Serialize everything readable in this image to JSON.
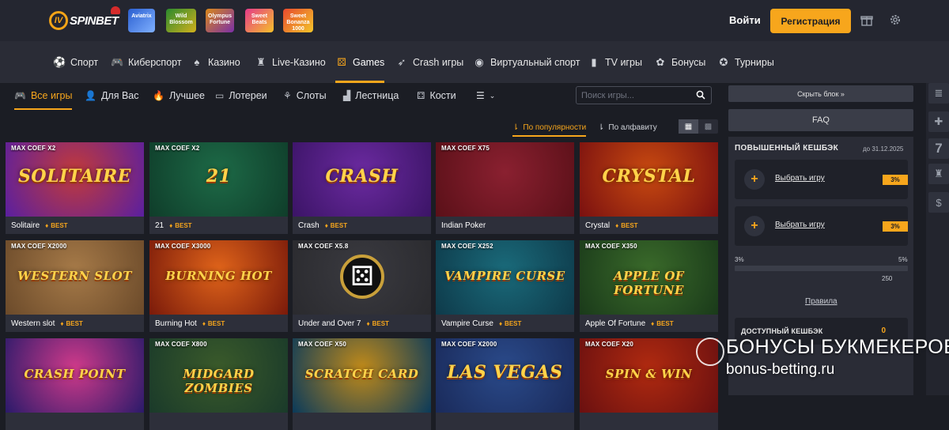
{
  "header": {
    "logo_text": "SPINBET",
    "promos": [
      "Aviatrix",
      "Wild Blossom",
      "Olympus Fortune",
      "Sweet Beats",
      "Sweet Bonanza 1000"
    ],
    "login_label": "Войти",
    "register_label": "Регистрация"
  },
  "main_nav": {
    "items": [
      {
        "label": "Спорт",
        "icon": "soccer-ball-icon"
      },
      {
        "label": "Киберспорт",
        "icon": "gamepad-icon"
      },
      {
        "label": "Казино",
        "icon": "cards-icon"
      },
      {
        "label": "Live-Казино",
        "icon": "dealer-icon"
      },
      {
        "label": "Games",
        "icon": "dice-icon"
      },
      {
        "label": "Crash игры",
        "icon": "rocket-icon"
      },
      {
        "label": "Виртуальный спорт",
        "icon": "controller-icon"
      },
      {
        "label": "TV игры",
        "icon": "tv-icon"
      },
      {
        "label": "Бонусы",
        "icon": "gift-icon"
      },
      {
        "label": "Турниры",
        "icon": "trophy-icon"
      }
    ],
    "active": "Games"
  },
  "sub_nav": {
    "items": [
      "Все игры",
      "Для Вас",
      "Лучшее",
      "Лотереи",
      "Слоты",
      "Лестница",
      "Кости"
    ],
    "active": "Все игры"
  },
  "search": {
    "placeholder": "Поиск игры..."
  },
  "sort": {
    "popular": "По популярности",
    "alpha": "По алфавиту",
    "active": "popular"
  },
  "games": [
    {
      "name": "Solitaire",
      "coef": "MAX COEF X2",
      "best": true,
      "art_title": "SOLITAIRE",
      "bg": [
        "#5a1fa0",
        "#c23a3a"
      ]
    },
    {
      "name": "21",
      "coef": "MAX COEF X2",
      "best": true,
      "art_title": "21",
      "bg": [
        "#0f3d2a",
        "#1d6a47"
      ]
    },
    {
      "name": "Crash",
      "coef": "",
      "best": true,
      "art_title": "CRASH",
      "bg": [
        "#3b1466",
        "#6b2aa0"
      ]
    },
    {
      "name": "Indian Poker",
      "coef": "MAX COEF X75",
      "best": false,
      "art_title": "",
      "bg": [
        "#5a1018",
        "#8a2030"
      ]
    },
    {
      "name": "Crystal",
      "coef": "",
      "best": true,
      "art_title": "CRYSTAL",
      "bg": [
        "#7a1010",
        "#c84a10"
      ]
    },
    {
      "name": "Western slot",
      "coef": "MAX COEF X2000",
      "best": true,
      "art_title": "WESTERN SLOT",
      "bg": [
        "#6b4a2a",
        "#a67a48"
      ]
    },
    {
      "name": "Burning Hot",
      "coef": "MAX COEF X3000",
      "best": true,
      "art_title": "BURNING HOT",
      "bg": [
        "#7a1a0a",
        "#e0641a"
      ]
    },
    {
      "name": "Under and Over 7",
      "coef": "MAX COEF X5.8",
      "best": true,
      "art_title": "",
      "bg": [
        "#2a2a2e",
        "#3a3a40"
      ]
    },
    {
      "name": "Vampire Curse",
      "coef": "MAX COEF X252",
      "best": true,
      "art_title": "VAMPIRE CURSE",
      "bg": [
        "#0e3a4a",
        "#1a6a7a"
      ]
    },
    {
      "name": "Apple Of Fortune",
      "coef": "MAX COEF X350",
      "best": true,
      "art_title": "APPLE OF FORTUNE",
      "bg": [
        "#1a3a1a",
        "#3a6a2a"
      ]
    },
    {
      "name": "",
      "coef": "",
      "best": false,
      "art_title": "CRASH POINT",
      "bg": [
        "#2a1a6a",
        "#d03a8a"
      ]
    },
    {
      "name": "",
      "coef": "MAX COEF X800",
      "best": false,
      "art_title": "MIDGARD ZOMBIES",
      "bg": [
        "#1a3a2a",
        "#3a5a2a"
      ]
    },
    {
      "name": "",
      "coef": "MAX COEF X50",
      "best": false,
      "art_title": "SCRATCH CARD",
      "bg": [
        "#0a3a5a",
        "#c08a1a"
      ]
    },
    {
      "name": "",
      "coef": "MAX COEF X2000",
      "best": false,
      "art_title": "LAS VEGAS",
      "bg": [
        "#1a2a5a",
        "#2a4a8a"
      ]
    },
    {
      "name": "",
      "coef": "MAX COEF X20",
      "best": false,
      "art_title": "SPIN & WIN",
      "bg": [
        "#6a1010",
        "#b02a10"
      ]
    }
  ],
  "best_label": "BEST",
  "sidebar": {
    "hide_label": "Скрыть блок »",
    "faq_label": "FAQ",
    "cashback_title": "ПОВЫШЕННЫЙ КЕШБЭК",
    "cashback_date": "до 31.12.2025",
    "rows": [
      {
        "link": "Выбрать игру",
        "pct": "3%"
      },
      {
        "link": "Выбрать игру",
        "pct": "3%"
      }
    ],
    "progress": {
      "min_label": "3%",
      "max_label": "5%",
      "fill_fraction": 0.0,
      "value_label": "250"
    },
    "rules_label": "Правила",
    "available_label": "ДОСТУПНЫЙ КЕШБЭК",
    "available_value": "0"
  },
  "watermark": {
    "line1": "БОНУСЫ БУКМЕКЕРОВ",
    "line2": "bonus-betting.ru"
  },
  "colors": {
    "accent": "#f7a61c",
    "bg": "#1b1d24",
    "nav": "#2a2c36"
  }
}
